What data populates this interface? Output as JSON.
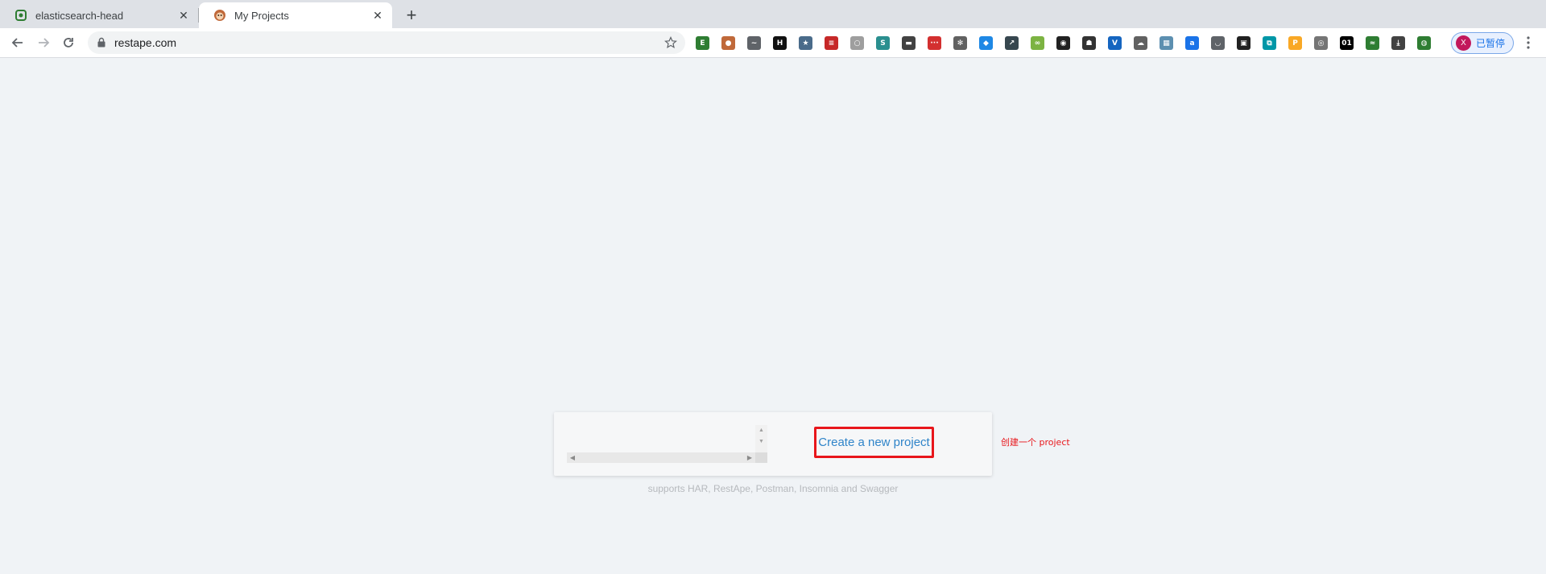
{
  "browser": {
    "tabs": [
      {
        "title": "elasticsearch-head",
        "active": false,
        "icon": "elasticsearch-icon"
      },
      {
        "title": "My Projects",
        "active": true,
        "icon": "monkey-icon"
      }
    ],
    "close_glyph": "✕",
    "new_tab_glyph": "+",
    "url": "restape.com",
    "profile": {
      "initial": "X",
      "label": "已暂停"
    }
  },
  "extensions": [
    {
      "name": "elasticsearch-icon",
      "color": "#2e7d32",
      "glyph": "E"
    },
    {
      "name": "monkey-icon",
      "color": "#c0693a",
      "glyph": "●"
    },
    {
      "name": "cowboy-hat-icon",
      "color": "#5f6368",
      "glyph": "~"
    },
    {
      "name": "h-icon",
      "color": "#111111",
      "glyph": "H"
    },
    {
      "name": "star-box-icon",
      "color": "#4a6b8a",
      "glyph": "★"
    },
    {
      "name": "flag-icon",
      "color": "#c62828",
      "glyph": "≡"
    },
    {
      "name": "circle-icon",
      "color": "#9e9e9e",
      "glyph": "○"
    },
    {
      "name": "s-icon",
      "color": "#2a8f8f",
      "glyph": "S"
    },
    {
      "name": "car-icon",
      "color": "#424242",
      "glyph": "▬"
    },
    {
      "name": "dots-icon",
      "color": "#d32f2f",
      "glyph": "···"
    },
    {
      "name": "gear-icon",
      "color": "#616161",
      "glyph": "✻"
    },
    {
      "name": "diamond-icon",
      "color": "#1e88e5",
      "glyph": "◆"
    },
    {
      "name": "chart-icon",
      "color": "#37474f",
      "glyph": "↗"
    },
    {
      "name": "bike-icon",
      "color": "#7cb342",
      "glyph": "∞"
    },
    {
      "name": "glasses-icon",
      "color": "#212121",
      "glyph": "◉"
    },
    {
      "name": "robot-icon",
      "color": "#333333",
      "glyph": "☗"
    },
    {
      "name": "v-icon",
      "color": "#1565c0",
      "glyph": "V"
    },
    {
      "name": "cloud-icon",
      "color": "#616161",
      "glyph": "☁"
    },
    {
      "name": "tiles-icon",
      "color": "#5c8fb0",
      "glyph": "▦"
    },
    {
      "name": "a-icon",
      "color": "#1a73e8",
      "glyph": "a"
    },
    {
      "name": "pocket-icon",
      "color": "#5f6368",
      "glyph": "◡"
    },
    {
      "name": "cookie-icon",
      "color": "#212121",
      "glyph": "▣"
    },
    {
      "name": "screenshot-icon",
      "color": "#0097a7",
      "glyph": "⧉"
    },
    {
      "name": "pdf-icon",
      "color": "#f9a825",
      "glyph": "P"
    },
    {
      "name": "circle-badge-icon",
      "color": "#757575",
      "glyph": "◎"
    },
    {
      "name": "binary-icon",
      "color": "#000000",
      "glyph": "01"
    },
    {
      "name": "leaf-icon",
      "color": "#2e7d32",
      "glyph": "≈"
    },
    {
      "name": "download-icon",
      "color": "#424242",
      "glyph": "⤓"
    },
    {
      "name": "globe-icon",
      "color": "#2e7d32",
      "glyph": "◍"
    }
  ],
  "main": {
    "create_link": "Create a new project",
    "supports": "supports HAR, RestApe, Postman, Insomnia and Swagger",
    "annotation": "创建一个 project"
  }
}
